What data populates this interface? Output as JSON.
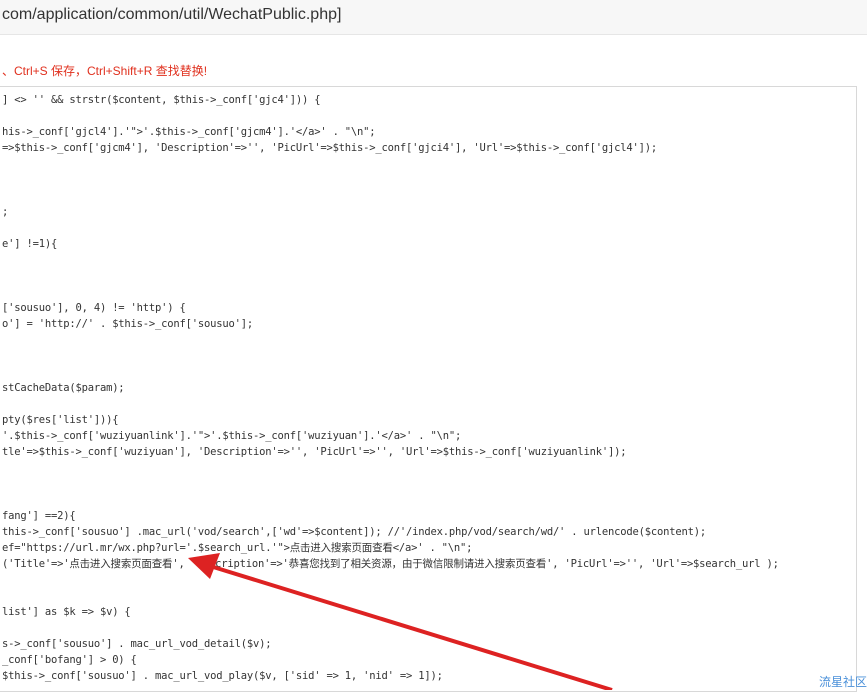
{
  "file_path": "com/application/common/util/WechatPublic.php]",
  "hint": "、Ctrl+S 保存，Ctrl+Shift+R 查找替换!",
  "code_lines": [
    {
      "text": "] <> '' && strstr($content, $this->_conf['gjc4'])) {"
    },
    {
      "text": "his->_conf['gjcl4'].'\">'.$this->_conf['gjcm4'].'</a>' . \"\\n\";"
    },
    {
      "text": "=>$this->_conf['gjcm4'], 'Description'=>'', 'PicUrl'=>$this->_conf['gjci4'], 'Url'=>$this->_conf['gjcl4']);"
    },
    {
      "text": ";"
    },
    {
      "text": "e'] !=1){"
    },
    {
      "text": "['sousuo'], 0, 4) != 'http') {"
    },
    {
      "text": "o'] = 'http://' . $this->_conf['sousuo'];"
    },
    {
      "text": "stCacheData($param);"
    },
    {
      "text": "pty($res['list'])){"
    },
    {
      "text": "'.$this->_conf['wuziyuanlink'].'\">'.$this->_conf['wuziyuan'].'</a>' . \"\\n\";"
    },
    {
      "text": "tle'=>$this->_conf['wuziyuan'], 'Description'=>'', 'PicUrl'=>'', 'Url'=>$this->_conf['wuziyuanlink']);"
    },
    {
      "text": "fang'] ==2){"
    },
    {
      "text": "this->_conf['sousuo'] .mac_url('vod/search',['wd'=>$content]); //'/index.php/vod/search/wd/' . urlencode($content);"
    },
    {
      "text": "ef=\"https://url.mr/wx.php?url='.$search_url.'\">点击进入搜索页面查看</a>' . \"\\n\";"
    },
    {
      "text": "('Title'=>'点击进入搜索页面查看', 'Description'=>'恭喜您找到了相关资源，由于微信限制请进入搜索页查看', 'PicUrl'=>'', 'Url'=>$search_url );"
    },
    {
      "text": "list'] as $k => $v) {"
    },
    {
      "text": "s->_conf['sousuo'] . mac_url_vod_detail($v);"
    },
    {
      "text": "_conf['bofang'] > 0) {"
    },
    {
      "text": "$this->_conf['sousuo'] . mac_url_vod_play($v, ['sid' => 1, 'nid' => 1]);"
    }
  ],
  "watermark": "流星社区",
  "colors": {
    "annotation_arrow": "#dd2222",
    "hint_text": "#e0301e"
  }
}
